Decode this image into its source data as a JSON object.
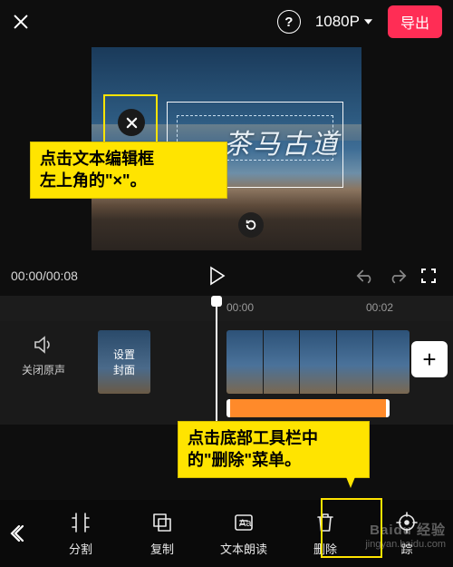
{
  "topbar": {
    "resolution": "1080P",
    "export": "导出"
  },
  "preview": {
    "text_content": "茶马古道"
  },
  "annotations": {
    "tip1_line1": "点击文本编辑框",
    "tip1_line2": "左上角的\"×\"。",
    "tip2_line1": "点击底部工具栏中",
    "tip2_line2": "的\"删除\"菜单。"
  },
  "controls": {
    "time": "00:00/00:08"
  },
  "ruler": {
    "t0": "00:00",
    "t1": "00:02"
  },
  "track": {
    "mute_label": "关闭原声",
    "cover_label": "设置\n封面",
    "add": "+"
  },
  "toolbar": {
    "split": "分割",
    "copy": "复制",
    "tts": "文本朗读",
    "delete": "删除",
    "track": "踪"
  },
  "watermark": {
    "brand": "Baidu 经验",
    "url": "jingyan.baidu.com"
  }
}
